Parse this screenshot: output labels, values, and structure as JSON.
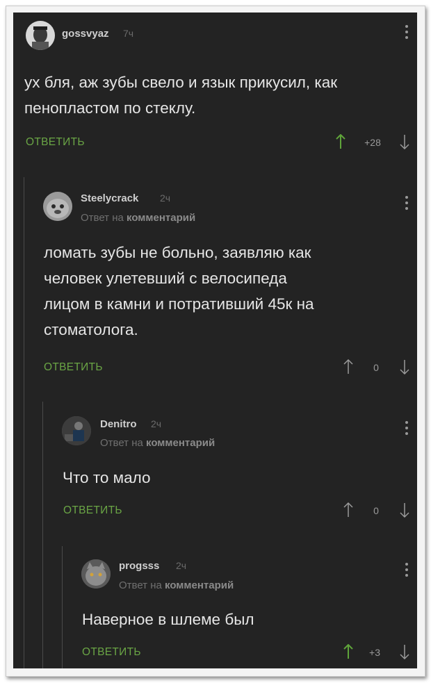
{
  "colors": {
    "background": "#232323",
    "text": "#e6e6e6",
    "reply_green": "#6aa545",
    "upvoted_green": "#5fa43a",
    "muted": "#9a9a9a"
  },
  "comments": [
    {
      "username": "gossvyaz",
      "time": "7ч",
      "text": "ух бля, аж зубы свело и язык прикусил, как\nпенопластом по стеклу.",
      "reply_label": "ОТВЕТИТЬ",
      "rating": "+28",
      "upvoted": true,
      "icons": {
        "avatar": "avatar-photo",
        "menu": "more-vertical-icon",
        "up": "arrow-up-icon",
        "down": "arrow-down-icon"
      }
    },
    {
      "username": "Steelycrack",
      "time": "2ч",
      "reply_prefix": "Ответ на ",
      "reply_target": "комментарий",
      "text": "ломать зубы не больно, заявляю как\nчеловек улетевший с велосипеда\nлицом в камни и потративший 45к на\nстоматолога.",
      "reply_label": "ОТВЕТИТЬ",
      "rating": "0",
      "upvoted": false
    },
    {
      "username": "Denitro",
      "time": "2ч",
      "reply_prefix": "Ответ на ",
      "reply_target": "комментарий",
      "text": "Что то мало",
      "reply_label": "ОТВЕТИТЬ",
      "rating": "0",
      "upvoted": false
    },
    {
      "username": "progsss",
      "time": "2ч",
      "reply_prefix": "Ответ на ",
      "reply_target": "комментарий",
      "text": "Наверное в шлеме был",
      "reply_label": "ОТВЕТИТЬ",
      "rating": "+3",
      "upvoted": true
    }
  ]
}
